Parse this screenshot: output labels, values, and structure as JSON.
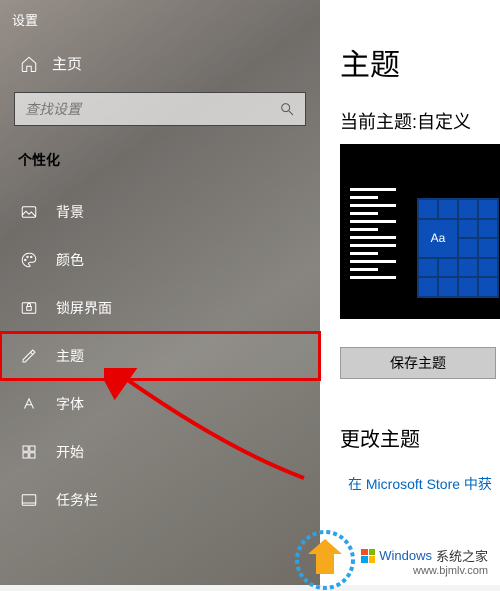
{
  "app_title": "设置",
  "home_label": "主页",
  "search": {
    "placeholder": "查找设置"
  },
  "category": "个性化",
  "nav": [
    {
      "label": "背景",
      "icon": "image-icon"
    },
    {
      "label": "颜色",
      "icon": "palette-icon"
    },
    {
      "label": "锁屏界面",
      "icon": "lockscreen-icon"
    },
    {
      "label": "主题",
      "icon": "theme-icon"
    },
    {
      "label": "字体",
      "icon": "font-icon"
    },
    {
      "label": "开始",
      "icon": "start-icon"
    },
    {
      "label": "任务栏",
      "icon": "taskbar-icon"
    }
  ],
  "main": {
    "title": "主题",
    "current_theme_label": "当前主题:自定义",
    "preview_tile_text": "Aa",
    "save_button": "保存主题",
    "change_theme_title": "更改主题",
    "store_link": "在 Microsoft Store 中获"
  },
  "watermark": {
    "brand": "Windows",
    "suffix": "系统之家",
    "url": "www.bjmlv.com"
  }
}
